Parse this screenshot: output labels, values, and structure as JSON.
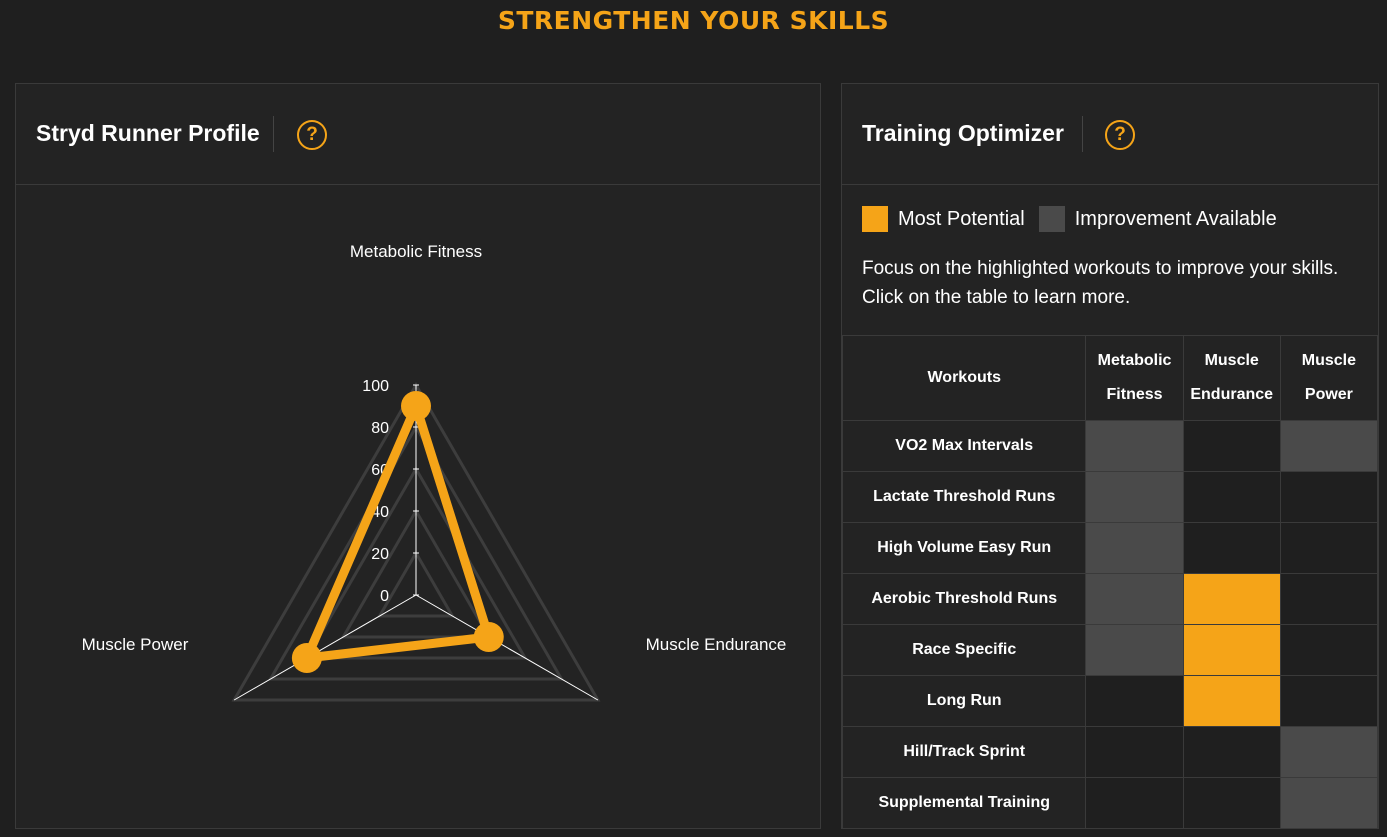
{
  "page_title": "STRENGTHEN YOUR SKILLS",
  "colors": {
    "accent": "#f5a418",
    "improvement": "#4a4a4a",
    "panel": "#232323",
    "background": "#1f1f1f"
  },
  "runner_profile": {
    "title": "Stryd Runner Profile",
    "help_icon": "question-circle-icon",
    "chart_data": {
      "type": "radar",
      "axes": [
        "Metabolic Fitness",
        "Muscle Endurance",
        "Muscle Power"
      ],
      "ticks": [
        "0",
        "20",
        "40",
        "60",
        "80",
        "100"
      ],
      "range": [
        0,
        100
      ],
      "series": [
        {
          "values": [
            90,
            40,
            60
          ]
        }
      ]
    }
  },
  "training_optimizer": {
    "title": "Training Optimizer",
    "help_icon": "question-circle-icon",
    "legend": {
      "most": "Most Potential",
      "improvement": "Improvement Available"
    },
    "description": "Focus on the highlighted workouts to improve your skills. Click on the table to learn more.",
    "table": {
      "header_workouts": "Workouts",
      "header_cols": [
        {
          "line1": "Metabolic",
          "line2": "Fitness"
        },
        {
          "line1": "Muscle",
          "line2": "Endurance"
        },
        {
          "line1": "Muscle",
          "line2": "Power"
        }
      ],
      "rows": [
        {
          "name": "VO2 Max Intervals",
          "cells": [
            "imp",
            "none",
            "imp"
          ]
        },
        {
          "name": "Lactate Threshold Runs",
          "cells": [
            "imp",
            "none",
            "none"
          ]
        },
        {
          "name": "High Volume Easy Run",
          "cells": [
            "imp",
            "none",
            "none"
          ]
        },
        {
          "name": "Aerobic Threshold Runs",
          "cells": [
            "imp",
            "most",
            "none"
          ]
        },
        {
          "name": "Race Specific",
          "cells": [
            "imp",
            "most",
            "none"
          ]
        },
        {
          "name": "Long Run",
          "cells": [
            "none",
            "most",
            "none"
          ]
        },
        {
          "name": "Hill/Track Sprint",
          "cells": [
            "none",
            "none",
            "imp"
          ]
        },
        {
          "name": "Supplemental Training",
          "cells": [
            "none",
            "none",
            "imp"
          ]
        }
      ]
    }
  }
}
